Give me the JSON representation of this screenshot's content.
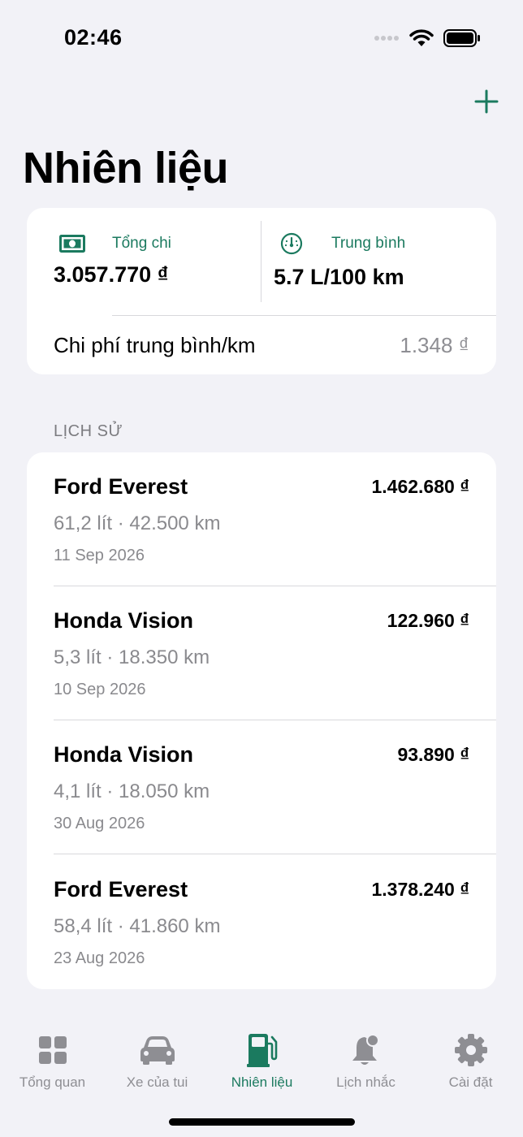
{
  "status_bar": {
    "time": "02:46"
  },
  "header": {
    "title": "Nhiên liệu"
  },
  "summary": {
    "total_label": "Tổng chi",
    "total_value": "3.057.770 ₫",
    "avg_label": "Trung bình",
    "avg_value": "5.7 L/100 km",
    "per_km_label": "Chi phí trung bình/km",
    "per_km_value": "1.348 ₫"
  },
  "history": {
    "section_title": "LỊCH SỬ",
    "entries": [
      {
        "vehicle": "Ford Everest",
        "amount": "1.462.680 ₫",
        "detail": "61,2 lít · 42.500 km",
        "date": "11 Sep 2026"
      },
      {
        "vehicle": "Honda Vision",
        "amount": "122.960 ₫",
        "detail": "5,3 lít · 18.350 km",
        "date": "10 Sep 2026"
      },
      {
        "vehicle": "Honda Vision",
        "amount": "93.890 ₫",
        "detail": "4,1 lít · 18.050 km",
        "date": "30 Aug 2026"
      },
      {
        "vehicle": "Ford Everest",
        "amount": "1.378.240 ₫",
        "detail": "58,4 lít · 41.860 km",
        "date": "23 Aug 2026"
      }
    ]
  },
  "tab_bar": {
    "items": [
      {
        "label": "Tổng quan",
        "icon": "grid-icon"
      },
      {
        "label": "Xe của tui",
        "icon": "car-icon"
      },
      {
        "label": "Nhiên liệu",
        "icon": "fuel-pump-icon",
        "active": true
      },
      {
        "label": "Lịch nhắc",
        "icon": "bell-icon"
      },
      {
        "label": "Cài đặt",
        "icon": "gear-icon"
      }
    ]
  },
  "colors": {
    "accent": "#1b7a5f",
    "background": "#f2f2f7",
    "inactive": "#8e8e93"
  }
}
